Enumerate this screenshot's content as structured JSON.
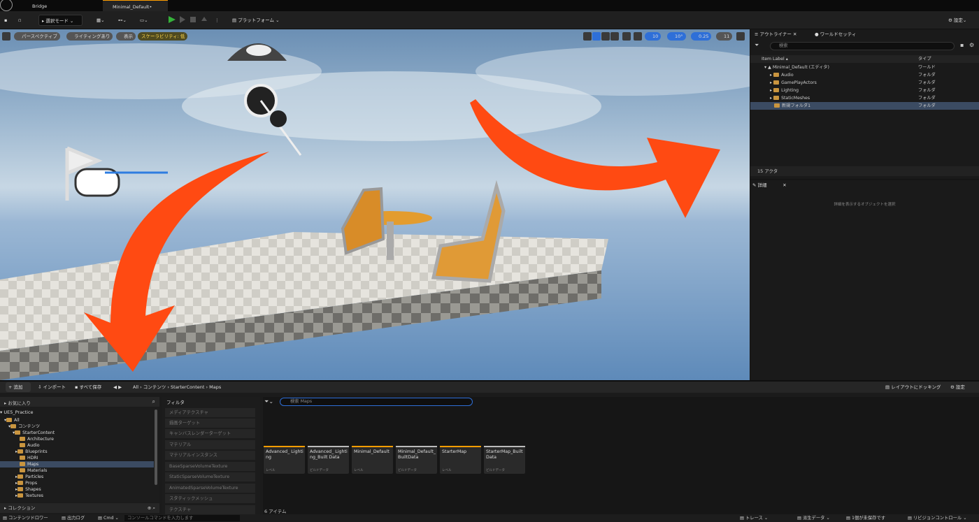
{
  "titlebar": {
    "tabs": [
      "Bridge",
      "Minimal_Default•"
    ]
  },
  "toolbar": {
    "mode": "選択モード",
    "platform": "プラットフォーム",
    "settings": "設定"
  },
  "viewport": {
    "view_mode": "パースペクティブ",
    "lighting": "ライティングあり",
    "show": "表示",
    "scalability": "スケーラビリティ: 低",
    "snap_grid": "10",
    "snap_angle": "10°",
    "snap_scale": "0.25",
    "camera_speed": "11"
  },
  "outliner": {
    "tab": "アウトライナー",
    "tab2": "ワールドセッティ",
    "search_placeholder": "検索",
    "col_label": "Item Label ▴",
    "col_type": "タイプ",
    "rows": [
      {
        "label": "Minimal_Default (エディタ)",
        "type": "ワールド"
      },
      {
        "label": "Audio",
        "type": "フォルダ"
      },
      {
        "label": "GamePlayActors",
        "type": "フォルダ"
      },
      {
        "label": "Lighting",
        "type": "フォルダ"
      },
      {
        "label": "StaticMeshes",
        "type": "フォルダ"
      },
      {
        "label": "新規フォルダ1",
        "type": "フォルダ"
      }
    ],
    "count": "15 アクタ"
  },
  "details": {
    "tab": "詳細",
    "hint": "詳細を表示するオブジェクトを選択"
  },
  "content": {
    "add": "追加",
    "import": "インポート",
    "save_all": "すべて保存",
    "breadcrumb": [
      "All",
      "コンテンツ",
      "StarterContent",
      "Maps"
    ],
    "dock": "レイアウトにドッキング",
    "settings": "設定",
    "favorites": "お気に入り",
    "project": "UE5_Practice",
    "collections": "コレクション",
    "tree": [
      "All",
      "コンテンツ",
      "StarterContent",
      "Architecture",
      "Audio",
      "Blueprints",
      "HDRI",
      "Maps",
      "Materials",
      "Particles",
      "Props",
      "Shapes",
      "Textures"
    ],
    "filters_title": "フィルタ",
    "filters": [
      "メディアテクスチャ",
      "描画ターゲット",
      "キャンバスレンダーターゲット",
      "マテリアル",
      "マテリアルインスタンス",
      "BaseSparseVolumeTexture",
      "StaticSparseVolumeTexture",
      "AnimatedSparseVolumeTexture",
      "スタティックメッシュ",
      "テクスチャ"
    ],
    "search_placeholder": "検索 Maps",
    "item_count": "6 アイテム",
    "assets": [
      {
        "name": "Advanced_ Lighting",
        "type": "レベル"
      },
      {
        "name": "Advanced_ Lighting_Built Data",
        "type": "ビルドデータ"
      },
      {
        "name": "Minimal_Default",
        "type": "レベル"
      },
      {
        "name": "Minimal_Default_ BuiltData",
        "type": "ビルドデータ"
      },
      {
        "name": "StarterMap",
        "type": "レベル"
      },
      {
        "name": "StarterMap_Built Data",
        "type": "ビルドデータ"
      }
    ]
  },
  "statusbar": {
    "drawer": "コンテンツドロワー",
    "log": "出力ログ",
    "cmd": "Cmd",
    "console_placeholder": "コンソールコマンドを入力します",
    "trace": "トレース",
    "derived": "派生データ",
    "unsaved": "1個が未保存です",
    "revision": "リビジョンコントロール"
  }
}
